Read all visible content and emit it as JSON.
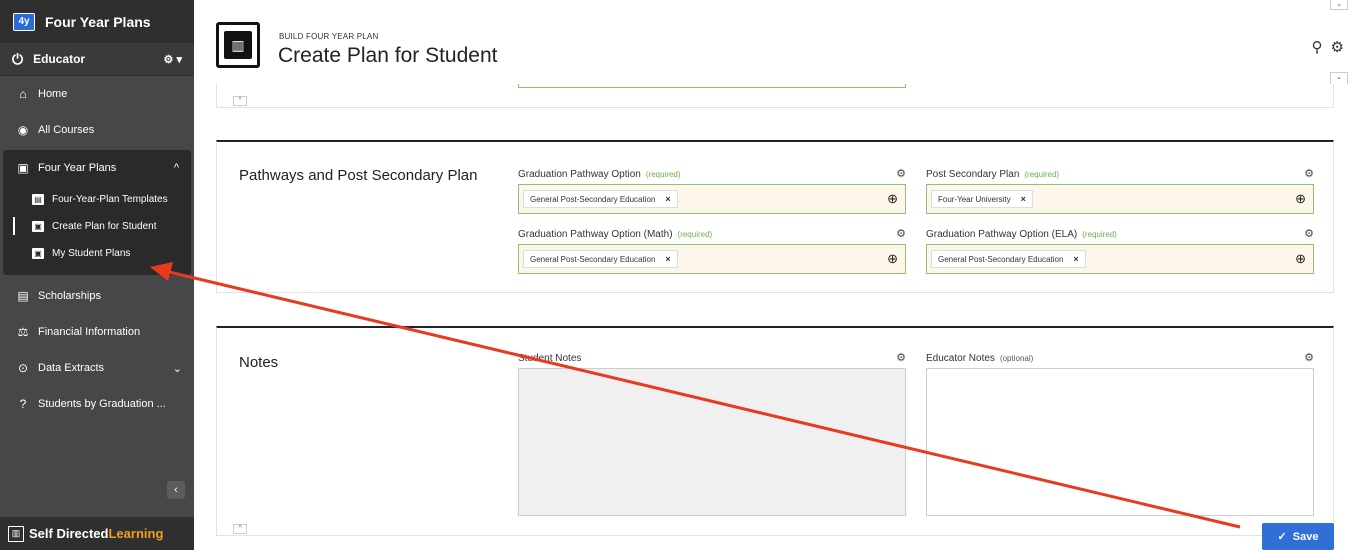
{
  "app": {
    "logo": "4y",
    "title": "Four Year Plans"
  },
  "role": {
    "label": "Educator"
  },
  "nav": {
    "home": "Home",
    "all_courses": "All Courses",
    "four_year_plans": "Four Year Plans",
    "sub": {
      "templates": "Four-Year-Plan Templates",
      "create": "Create Plan for Student",
      "my_plans": "My Student Plans"
    },
    "scholarships": "Scholarships",
    "financial": "Financial Information",
    "data_extracts": "Data Extracts",
    "students_by_grad": "Students by Graduation ..."
  },
  "footer": {
    "brand_main": "Self Directed",
    "brand_accent": "Learning"
  },
  "header": {
    "subtitle": "BUILD FOUR YEAR PLAN",
    "title": "Create Plan for Student"
  },
  "pathways": {
    "title": "Pathways and Post Secondary Plan",
    "fields": {
      "grad_option": {
        "label": "Graduation Pathway Option",
        "req": "(required)",
        "value": "General Post-Secondary Education"
      },
      "post_secondary": {
        "label": "Post Secondary Plan",
        "req": "(required)",
        "value": "Four-Year University"
      },
      "grad_math": {
        "label": "Graduation Pathway Option (Math)",
        "req": "(required)",
        "value": "General Post-Secondary Education"
      },
      "grad_ela": {
        "label": "Graduation Pathway Option (ELA)",
        "req": "(required)",
        "value": "General Post-Secondary Education"
      }
    }
  },
  "notes": {
    "title": "Notes",
    "student_label": "Student Notes",
    "educator_label": "Educator Notes",
    "educator_opt": "(optional)"
  },
  "save": {
    "label": "Save"
  },
  "colors": {
    "accent": "#2f6fd6",
    "required": "#6ab04c",
    "annotation": "#e83a1e",
    "sidebar": "#474747"
  }
}
